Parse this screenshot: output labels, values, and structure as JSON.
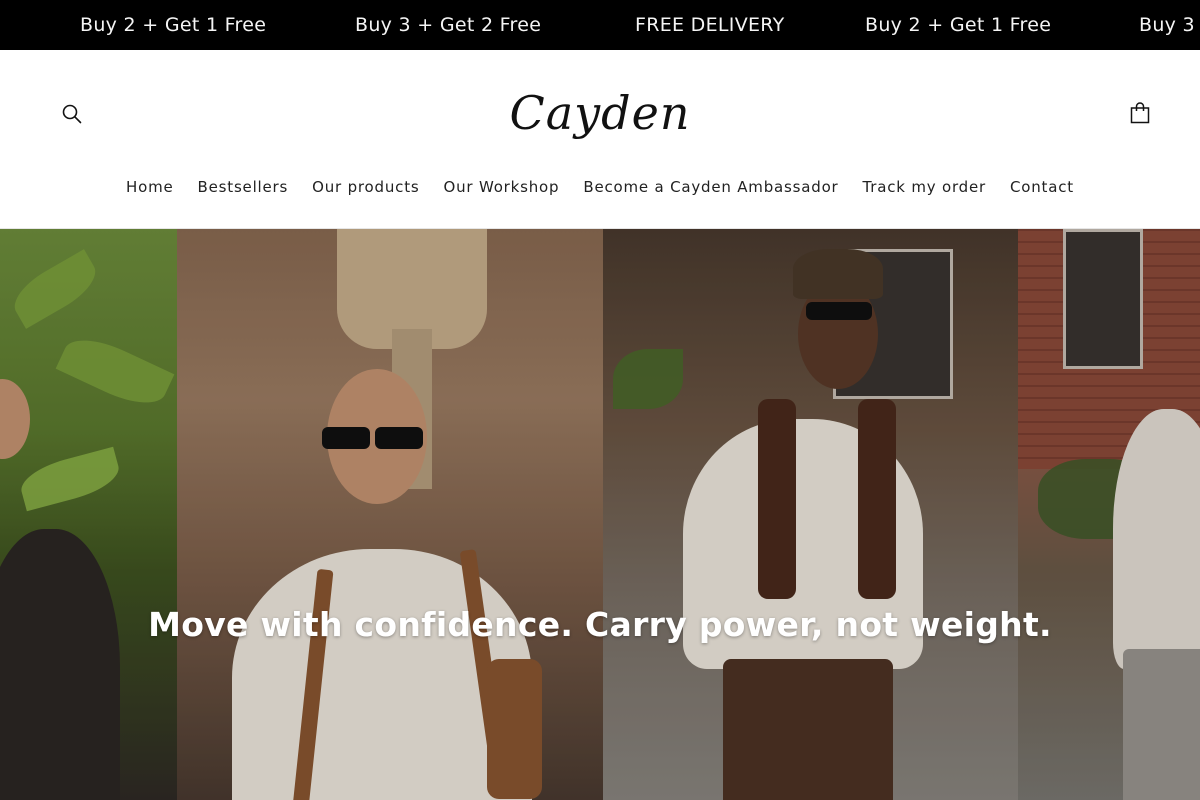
{
  "announcement": {
    "messages": [
      "Buy 2 + Get 1 Free",
      "Buy 3 + Get 2 Free",
      "FREE DELIVERY",
      "Buy 2 + Get 1 Free",
      "Buy 3"
    ],
    "background": "#000000",
    "text_color": "#ffffff"
  },
  "header": {
    "logo_text": "Cayden",
    "search_icon": "search-icon",
    "cart_icon": "shopping-bag-icon"
  },
  "nav": {
    "items": [
      "Home",
      "Bestsellers",
      "Our products",
      "Our Workshop",
      "Become a Cayden Ambassador",
      "Track my order",
      "Contact"
    ]
  },
  "hero": {
    "title": "Move with confidence. Carry power, not weight."
  }
}
